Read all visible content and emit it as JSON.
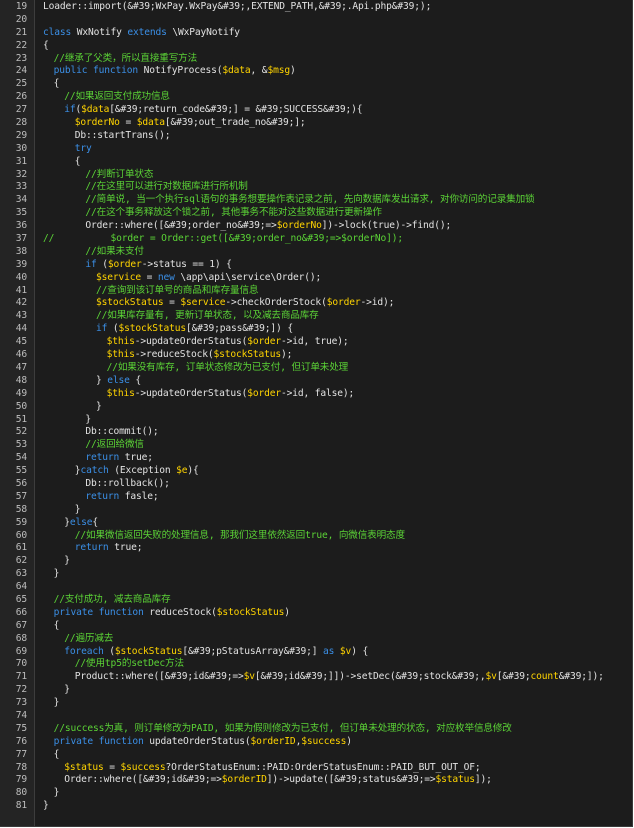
{
  "colors": {
    "background": "#1c1c1c",
    "gutter": "#242424",
    "line_number": "#bdbdbd",
    "plain": "#e2e2e2",
    "keyword": "#3b8fe6",
    "variable": "#ffd400",
    "comment": "#5bd336"
  },
  "lines": [
    {
      "n": "19",
      "i": 0,
      "tokens": [
        [
          "p",
          "Loader::import(&#39;WxPay.WxPay&#39;,EXTEND_PATH,&#39;.Api.php&#39;);"
        ]
      ]
    },
    {
      "n": "20",
      "i": 0,
      "tokens": []
    },
    {
      "n": "21",
      "i": 0,
      "tokens": [
        [
          "k",
          "class"
        ],
        [
          "p",
          " WxNotify "
        ],
        [
          "k",
          "extends"
        ],
        [
          "p",
          " \\WxPayNotify"
        ]
      ]
    },
    {
      "n": "22",
      "i": 0,
      "tokens": [
        [
          "p",
          "{"
        ]
      ]
    },
    {
      "n": "23",
      "i": 1,
      "tokens": [
        [
          "c",
          "//继承了父类，所以直接重写方法"
        ]
      ]
    },
    {
      "n": "24",
      "i": 1,
      "tokens": [
        [
          "k",
          "public"
        ],
        [
          "p",
          " "
        ],
        [
          "k",
          "function"
        ],
        [
          "p",
          " NotifyProcess("
        ],
        [
          "v",
          "$data"
        ],
        [
          "p",
          ", &"
        ],
        [
          "v",
          "$msg"
        ],
        [
          "p",
          ")"
        ]
      ]
    },
    {
      "n": "25",
      "i": 1,
      "tokens": [
        [
          "p",
          "{"
        ]
      ]
    },
    {
      "n": "26",
      "i": 2,
      "tokens": [
        [
          "c",
          "//如果返回支付成功信息"
        ]
      ]
    },
    {
      "n": "27",
      "i": 2,
      "tokens": [
        [
          "k",
          "if"
        ],
        [
          "p",
          "("
        ],
        [
          "v",
          "$data"
        ],
        [
          "p",
          "[&#39;return_code&#39;] = &#39;SUCCESS&#39;){"
        ]
      ]
    },
    {
      "n": "28",
      "i": 3,
      "tokens": [
        [
          "v",
          "$orderNo"
        ],
        [
          "p",
          " = "
        ],
        [
          "v",
          "$data"
        ],
        [
          "p",
          "[&#39;out_trade_no&#39;];"
        ]
      ]
    },
    {
      "n": "29",
      "i": 3,
      "tokens": [
        [
          "p",
          "Db::startTrans();"
        ]
      ]
    },
    {
      "n": "30",
      "i": 3,
      "tokens": [
        [
          "k",
          "try"
        ]
      ]
    },
    {
      "n": "31",
      "i": 3,
      "tokens": [
        [
          "p",
          "{"
        ]
      ]
    },
    {
      "n": "32",
      "i": 4,
      "tokens": [
        [
          "c",
          "//判断订单状态"
        ]
      ]
    },
    {
      "n": "33",
      "i": 4,
      "tokens": [
        [
          "c",
          "//在这里可以进行对数据库进行所机制"
        ]
      ]
    },
    {
      "n": "34",
      "i": 4,
      "tokens": [
        [
          "c",
          "//简单说, 当一个执行sql语句的事务想要操作表记录之前, 先向数据库发出请求, 对你访问的记录集加锁"
        ]
      ]
    },
    {
      "n": "35",
      "i": 4,
      "tokens": [
        [
          "c",
          "//在这个事务释放这个锁之前, 其他事务不能对这些数据进行更新操作"
        ]
      ]
    },
    {
      "n": "36",
      "i": 4,
      "tokens": [
        [
          "p",
          "Order::where([&#39;order_no&#39;=>"
        ],
        [
          "v",
          "$orderNo"
        ],
        [
          "p",
          "])->lock(true)->find();"
        ]
      ]
    },
    {
      "n": "37",
      "i": 0,
      "tokens": [
        [
          "c",
          "//          $order = Order::get([&#39;order_no&#39;=>$orderNo]);"
        ]
      ]
    },
    {
      "n": "38",
      "i": 4,
      "tokens": [
        [
          "c",
          "//如果未支付"
        ]
      ]
    },
    {
      "n": "39",
      "i": 4,
      "tokens": [
        [
          "k",
          "if"
        ],
        [
          "p",
          " ("
        ],
        [
          "v",
          "$order"
        ],
        [
          "p",
          "->status == 1) {"
        ]
      ]
    },
    {
      "n": "40",
      "i": 5,
      "tokens": [
        [
          "v",
          "$service"
        ],
        [
          "p",
          " = "
        ],
        [
          "k",
          "new"
        ],
        [
          "p",
          " \\app\\api\\service\\Order();"
        ]
      ]
    },
    {
      "n": "41",
      "i": 5,
      "tokens": [
        [
          "c",
          "//查询到该订单号的商品和库存量信息"
        ]
      ]
    },
    {
      "n": "42",
      "i": 5,
      "tokens": [
        [
          "v",
          "$stockStatus"
        ],
        [
          "p",
          " = "
        ],
        [
          "v",
          "$service"
        ],
        [
          "p",
          "->checkOrderStock("
        ],
        [
          "v",
          "$order"
        ],
        [
          "p",
          "->id);"
        ]
      ]
    },
    {
      "n": "43",
      "i": 5,
      "tokens": [
        [
          "c",
          "//如果库存量有, 更新订单状态, 以及减去商品库存"
        ]
      ]
    },
    {
      "n": "44",
      "i": 5,
      "tokens": [
        [
          "k",
          "if"
        ],
        [
          "p",
          " ("
        ],
        [
          "v",
          "$stockStatus"
        ],
        [
          "p",
          "[&#39;pass&#39;]) {"
        ]
      ]
    },
    {
      "n": "45",
      "i": 6,
      "tokens": [
        [
          "v",
          "$this"
        ],
        [
          "p",
          "->updateOrderStatus("
        ],
        [
          "v",
          "$order"
        ],
        [
          "p",
          "->id, true);"
        ]
      ]
    },
    {
      "n": "46",
      "i": 6,
      "tokens": [
        [
          "v",
          "$this"
        ],
        [
          "p",
          "->reduceStock("
        ],
        [
          "v",
          "$stockStatus"
        ],
        [
          "p",
          ");"
        ]
      ]
    },
    {
      "n": "47",
      "i": 6,
      "tokens": [
        [
          "c",
          "//如果没有库存, 订单状态修改为已支付, 但订单未处理"
        ]
      ]
    },
    {
      "n": "48",
      "i": 5,
      "tokens": [
        [
          "p",
          "} "
        ],
        [
          "k",
          "else"
        ],
        [
          "p",
          " {"
        ]
      ]
    },
    {
      "n": "49",
      "i": 6,
      "tokens": [
        [
          "v",
          "$this"
        ],
        [
          "p",
          "->updateOrderStatus("
        ],
        [
          "v",
          "$order"
        ],
        [
          "p",
          "->id, false);"
        ]
      ]
    },
    {
      "n": "50",
      "i": 5,
      "tokens": [
        [
          "p",
          "}"
        ]
      ]
    },
    {
      "n": "51",
      "i": 4,
      "tokens": [
        [
          "p",
          "}"
        ]
      ]
    },
    {
      "n": "52",
      "i": 4,
      "tokens": [
        [
          "p",
          "Db::commit();"
        ]
      ]
    },
    {
      "n": "53",
      "i": 4,
      "tokens": [
        [
          "c",
          "//返回给微信"
        ]
      ]
    },
    {
      "n": "54",
      "i": 4,
      "tokens": [
        [
          "k",
          "return"
        ],
        [
          "p",
          " true;"
        ]
      ]
    },
    {
      "n": "55",
      "i": 3,
      "tokens": [
        [
          "p",
          "}"
        ],
        [
          "k",
          "catch"
        ],
        [
          "p",
          " (Exception "
        ],
        [
          "v",
          "$e"
        ],
        [
          "p",
          "){"
        ]
      ]
    },
    {
      "n": "56",
      "i": 4,
      "tokens": [
        [
          "p",
          "Db::rollback();"
        ]
      ]
    },
    {
      "n": "57",
      "i": 4,
      "tokens": [
        [
          "k",
          "return"
        ],
        [
          "p",
          " fasle;"
        ]
      ]
    },
    {
      "n": "58",
      "i": 3,
      "tokens": [
        [
          "p",
          "}"
        ]
      ]
    },
    {
      "n": "59",
      "i": 2,
      "tokens": [
        [
          "p",
          "}"
        ],
        [
          "k",
          "else"
        ],
        [
          "p",
          "{"
        ]
      ]
    },
    {
      "n": "60",
      "i": 3,
      "tokens": [
        [
          "c",
          "//如果微信返回失败的处理信息, 那我们这里依然返回true, 向微信表明态度"
        ]
      ]
    },
    {
      "n": "61",
      "i": 3,
      "tokens": [
        [
          "k",
          "return"
        ],
        [
          "p",
          " true;"
        ]
      ]
    },
    {
      "n": "62",
      "i": 2,
      "tokens": [
        [
          "p",
          "}"
        ]
      ]
    },
    {
      "n": "63",
      "i": 1,
      "tokens": [
        [
          "p",
          "}"
        ]
      ]
    },
    {
      "n": "64",
      "i": 0,
      "tokens": []
    },
    {
      "n": "65",
      "i": 1,
      "tokens": [
        [
          "c",
          "//支付成功, 减去商品库存"
        ]
      ]
    },
    {
      "n": "66",
      "i": 1,
      "tokens": [
        [
          "k",
          "private"
        ],
        [
          "p",
          " "
        ],
        [
          "k",
          "function"
        ],
        [
          "p",
          " reduceStock("
        ],
        [
          "v",
          "$stockStatus"
        ],
        [
          "p",
          ")"
        ]
      ]
    },
    {
      "n": "67",
      "i": 1,
      "tokens": [
        [
          "p",
          "{"
        ]
      ]
    },
    {
      "n": "68",
      "i": 2,
      "tokens": [
        [
          "c",
          "//遍历减去"
        ]
      ]
    },
    {
      "n": "69",
      "i": 2,
      "tokens": [
        [
          "k",
          "foreach"
        ],
        [
          "p",
          " ("
        ],
        [
          "v",
          "$stockStatus"
        ],
        [
          "p",
          "[&#39;pStatusArray&#39;] "
        ],
        [
          "k",
          "as"
        ],
        [
          "p",
          " "
        ],
        [
          "v",
          "$v"
        ],
        [
          "p",
          ") {"
        ]
      ]
    },
    {
      "n": "70",
      "i": 3,
      "tokens": [
        [
          "c",
          "//使用tp5的setDec方法"
        ]
      ]
    },
    {
      "n": "71",
      "i": 3,
      "tokens": [
        [
          "p",
          "Product::where([&#39;id&#39;=>"
        ],
        [
          "v",
          "$v"
        ],
        [
          "p",
          "[&#39;id&#39;]])->setDec(&#39;stock&#39;,"
        ],
        [
          "v",
          "$v"
        ],
        [
          "p",
          "[&#39;"
        ],
        [
          "v",
          "count"
        ],
        [
          "p",
          "&#39;]);"
        ]
      ]
    },
    {
      "n": "72",
      "i": 2,
      "tokens": [
        [
          "p",
          "}"
        ]
      ]
    },
    {
      "n": "73",
      "i": 1,
      "tokens": [
        [
          "p",
          "}"
        ]
      ]
    },
    {
      "n": "74",
      "i": 0,
      "tokens": []
    },
    {
      "n": "75",
      "i": 1,
      "tokens": [
        [
          "c",
          "//success为真, 则订单修改为PAID, 如果为假则修改为已支付, 但订单未处理的状态, 对应枚举信息修改"
        ]
      ]
    },
    {
      "n": "76",
      "i": 1,
      "tokens": [
        [
          "k",
          "private"
        ],
        [
          "p",
          " "
        ],
        [
          "k",
          "function"
        ],
        [
          "p",
          " updateOrderStatus("
        ],
        [
          "v",
          "$orderID"
        ],
        [
          "p",
          ","
        ],
        [
          "v",
          "$success"
        ],
        [
          "p",
          ")"
        ]
      ]
    },
    {
      "n": "77",
      "i": 1,
      "tokens": [
        [
          "p",
          "{"
        ]
      ]
    },
    {
      "n": "78",
      "i": 2,
      "tokens": [
        [
          "v",
          "$status"
        ],
        [
          "p",
          " = "
        ],
        [
          "v",
          "$success"
        ],
        [
          "p",
          "?OrderStatusEnum::PAID:OrderStatusEnum::PAID_BUT_OUT_OF;"
        ]
      ]
    },
    {
      "n": "79",
      "i": 2,
      "tokens": [
        [
          "p",
          "Order::where([&#39;id&#39;=>"
        ],
        [
          "v",
          "$orderID"
        ],
        [
          "p",
          "])->update([&#39;status&#39;=>"
        ],
        [
          "v",
          "$status"
        ],
        [
          "p",
          "]);"
        ]
      ]
    },
    {
      "n": "80",
      "i": 1,
      "tokens": [
        [
          "p",
          "}"
        ]
      ]
    },
    {
      "n": "81",
      "i": 0,
      "tokens": [
        [
          "p",
          "}"
        ]
      ]
    }
  ]
}
